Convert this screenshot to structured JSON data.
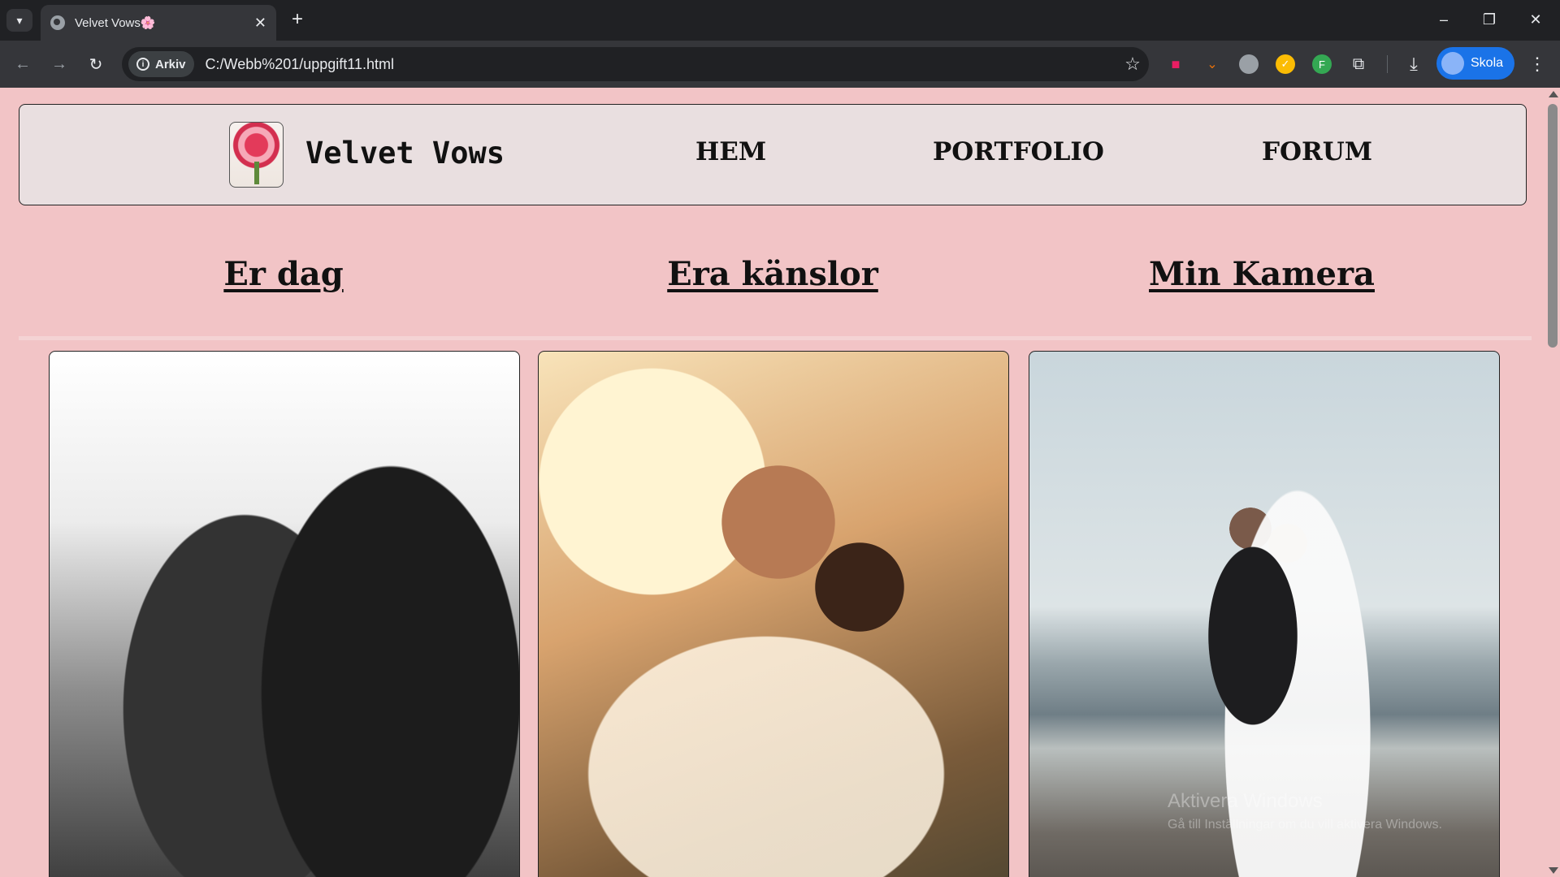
{
  "browser": {
    "tab_title": "Velvet Vows🌸",
    "new_tab": "+",
    "tab_close": "✕",
    "security_chip": "Arkiv",
    "url": "C:/Webb%201/uppgift11.html",
    "profile_name": "Skola",
    "icons": {
      "tab_search": "▾",
      "back": "←",
      "forward": "→",
      "reload": "↻",
      "star": "☆",
      "download": "⤓",
      "extensions": "⧉",
      "menu": "⋮",
      "minimize": "–",
      "maximize": "❐",
      "close": "✕"
    },
    "extension_colors": [
      "#e91e63",
      "#e8710a",
      "#9aa0a6",
      "#fbbc04",
      "#34a853"
    ]
  },
  "site": {
    "brand": "Velvet Vows",
    "nav": [
      "HEM",
      "PORTFOLIO",
      "FORUM"
    ],
    "sections": [
      "Er dag",
      "Era känslor",
      "Min Kamera"
    ]
  },
  "os_watermark": {
    "line1": "Aktivera Windows",
    "line2": "Gå till Inställningar om du vill aktivera Windows."
  },
  "colors": {
    "page_background": "#f2c4c6",
    "header_background": "#e9dfe0",
    "chrome_dark": "#202124",
    "chrome_toolbar": "#35363a",
    "profile_blue": "#1a73e8"
  }
}
